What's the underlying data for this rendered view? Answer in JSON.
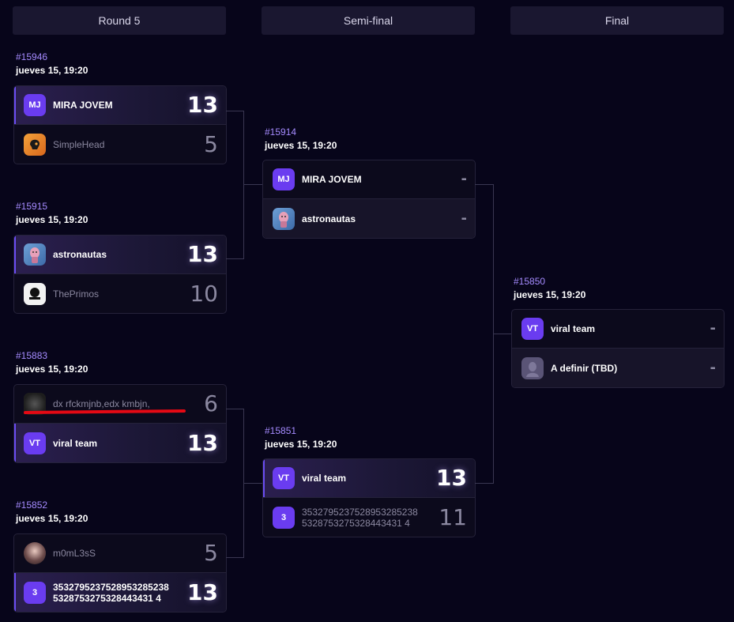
{
  "rounds": [
    {
      "label": "Round 5"
    },
    {
      "label": "Semi-final"
    },
    {
      "label": "Final"
    }
  ],
  "matches": [
    {
      "id": "#15946",
      "date": "jueves 15, 19:20",
      "teams": [
        {
          "initials": "MJ",
          "name": "MIRA JOVEM",
          "score": "13"
        },
        {
          "initials": "",
          "name": "SimpleHead",
          "score": "5"
        }
      ]
    },
    {
      "id": "#15915",
      "date": "jueves 15, 19:20",
      "teams": [
        {
          "initials": "",
          "name": "astronautas",
          "score": "13"
        },
        {
          "initials": "",
          "name": "ThePrimos",
          "score": "10"
        }
      ]
    },
    {
      "id": "#15883",
      "date": "jueves 15, 19:20",
      "teams": [
        {
          "initials": "",
          "name": "dx rfckmjnb,edx kmbjn,",
          "score": "6"
        },
        {
          "initials": "VT",
          "name": "viral team",
          "score": "13"
        }
      ]
    },
    {
      "id": "#15852",
      "date": "jueves 15, 19:20",
      "teams": [
        {
          "initials": "",
          "name": "m0mL3sS",
          "score": "5"
        },
        {
          "initials": "3",
          "name": "35327952375289532852385328753275328443431 4",
          "score": "13"
        }
      ]
    },
    {
      "id": "#15914",
      "date": "jueves 15, 19:20",
      "teams": [
        {
          "initials": "MJ",
          "name": "MIRA JOVEM",
          "score": "-"
        },
        {
          "initials": "",
          "name": "astronautas",
          "score": "-"
        }
      ]
    },
    {
      "id": "#15851",
      "date": "jueves 15, 19:20",
      "teams": [
        {
          "initials": "VT",
          "name": "viral team",
          "score": "13"
        },
        {
          "initials": "3",
          "name": "35327952375289532852385328753275328443431 4",
          "score": "11"
        }
      ]
    },
    {
      "id": "#15850",
      "date": "jueves 15, 19:20",
      "teams": [
        {
          "initials": "VT",
          "name": "viral team",
          "score": "-"
        },
        {
          "initials": "",
          "name": "A definir (TBD)",
          "score": "-"
        }
      ]
    }
  ],
  "long_team_name_lines": [
    "3532795237528953285238",
    "5328753275328443431 4"
  ],
  "colors": {
    "accent": "#6a3cf0",
    "id_text": "#a58bff",
    "annotation_red": "#e50914"
  }
}
